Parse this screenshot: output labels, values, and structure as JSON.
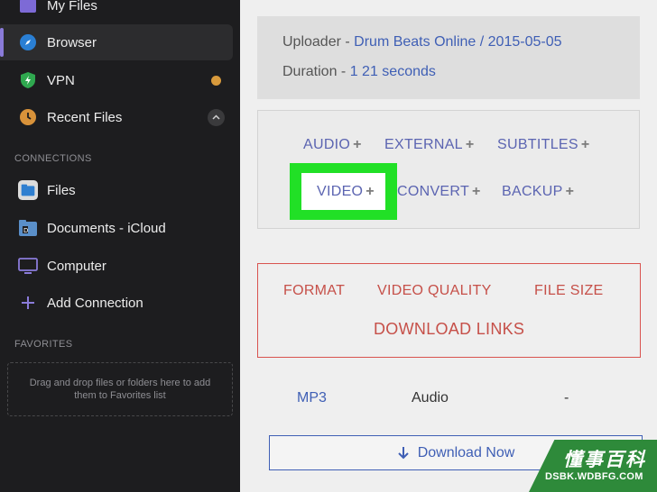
{
  "sidebar": {
    "items": [
      {
        "label": "My Files",
        "icon": "folder-icon"
      },
      {
        "label": "Browser",
        "icon": "compass-icon"
      },
      {
        "label": "VPN",
        "icon": "shield-icon"
      },
      {
        "label": "Recent Files",
        "icon": "clock-icon"
      }
    ],
    "connections_heading": "CONNECTIONS",
    "connections": [
      {
        "label": "Files",
        "icon": "files-app-icon"
      },
      {
        "label": "Documents - iCloud",
        "icon": "documents-folder-icon"
      },
      {
        "label": "Computer",
        "icon": "computer-icon"
      },
      {
        "label": "Add Connection",
        "icon": "plus-icon"
      }
    ],
    "favorites_heading": "FAVORITES",
    "favorites_hint": "Drag and drop files or folders here to add them to Favorites list"
  },
  "info": {
    "uploader_label": "Uploader - ",
    "uploader_value": "Drum Beats Online / 2015-05-05",
    "duration_label": "Duration - ",
    "duration_value": "1 21 seconds"
  },
  "tabs": [
    "AUDIO",
    "EXTERNAL",
    "SUBTITLES",
    "VIDEO",
    "CONVERT",
    "BACKUP"
  ],
  "plus_glyph": "+",
  "formats": {
    "format": "FORMAT",
    "video_quality": "VIDEO QUALITY",
    "file_size": "FILE SIZE",
    "download_links": "DOWNLOAD LINKS"
  },
  "row": {
    "format": "MP3",
    "quality": "Audio",
    "size": "-"
  },
  "download_button": "Download Now",
  "watermark": {
    "title": "懂事百科",
    "sub": "DSBK.WDBFG.COM"
  },
  "colors": {
    "accent": "#8a7bd9",
    "link": "#3f5fb5",
    "highlight": "#21e026",
    "warning": "#c65049"
  }
}
